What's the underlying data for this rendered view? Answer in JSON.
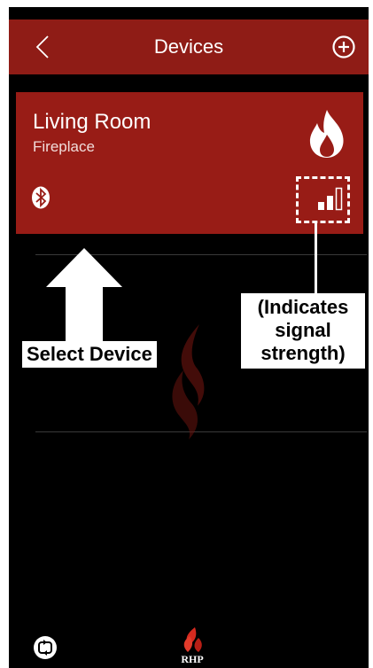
{
  "header": {
    "title": "Devices",
    "back_icon": "chevron-left-icon",
    "add_icon": "plus-circle-icon"
  },
  "device": {
    "name": "Living Room",
    "type": "Fireplace",
    "type_icon": "flame-icon",
    "connection_icon": "bluetooth-icon",
    "signal_icon": "signal-strength-icon",
    "signal_level": 0.66
  },
  "annotations": {
    "select_device": "Select Device",
    "signal_note_lines": [
      "(Indicates",
      "signal",
      "strength)"
    ]
  },
  "footer": {
    "refresh_icon": "refresh-icon",
    "brand": "RHP"
  },
  "colors": {
    "header": "#8f1c16",
    "card": "#981c16",
    "background": "#000000"
  }
}
